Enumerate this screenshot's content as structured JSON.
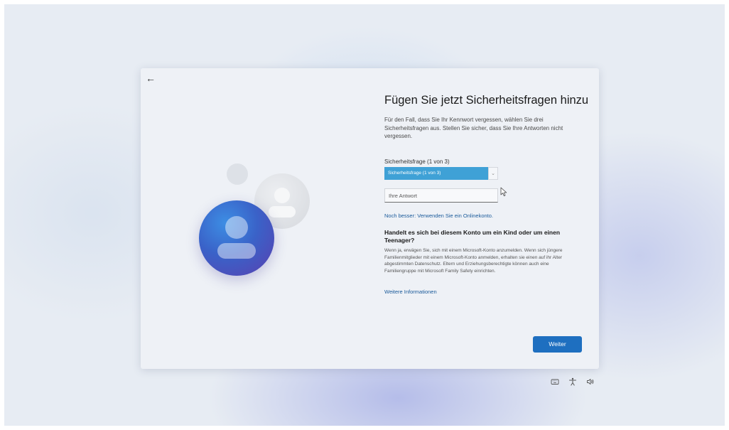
{
  "window": {
    "back_glyph": "←",
    "title": "Fügen Sie jetzt Sicherheitsfragen hinzu",
    "description": "Für den Fall, dass Sie Ihr Kennwort vergessen, wählen Sie drei Sicherheitsfragen aus. Stellen Sie sicher, dass Sie Ihre Antworten nicht vergessen."
  },
  "form": {
    "question_label": "Sicherheitsfrage (1 von 3)",
    "question_selected": "Sicherheitsfrage (1 von 3)",
    "dropdown_chevron": "⌄",
    "answer_placeholder": "Ihre Antwort",
    "online_link": "Noch besser: Verwenden Sie ein Onlinekonto."
  },
  "child_section": {
    "heading": "Handelt es sich bei diesem Konto um ein Kind oder um einen Teenager?",
    "body": "Wenn ja, erwägen Sie, sich mit einem Microsoft-Konto anzumelden. Wenn sich jüngere Familienmitglieder mit einem Microsoft-Konto anmelden, erhalten sie einen auf ihr Alter abgestimmten Datenschutz. Eltern und Erziehungsberechtigte können auch eine Familiengruppe mit Microsoft Family Safety einrichten.",
    "more_link": "Weitere Informationen"
  },
  "footer": {
    "next_label": "Weiter"
  },
  "tray_icons": [
    "keyboard-icon",
    "accessibility-icon",
    "volume-icon"
  ],
  "colors": {
    "dropdown_selected": "#3fa1d6",
    "primary_button": "#1e6fc0",
    "link": "#1a5a9a",
    "avatar_blue": "#3a62c8",
    "avatar_purple": "#5a3fb0"
  }
}
